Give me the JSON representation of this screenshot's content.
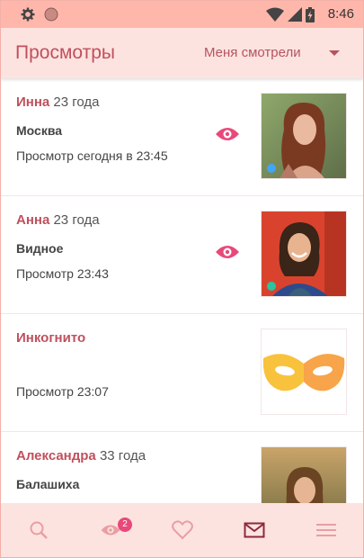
{
  "status": {
    "time": "8:46",
    "icons": [
      "gear-icon",
      "record-icon",
      "wifi-icon",
      "signal-icon",
      "battery-icon"
    ]
  },
  "header": {
    "title": "Просмотры",
    "filter_label": "Меня смотрели"
  },
  "rows": [
    {
      "name": "Инна",
      "age": "23 года",
      "city": "Москва",
      "viewed": "Просмотр сегодня в 23:45",
      "eye": true,
      "online_color": "#42a5f5"
    },
    {
      "name": "Анна",
      "age": "23 года",
      "city": "Видное",
      "viewed": "Просмотр 23:43",
      "eye": true,
      "online_color": "#26c6a0"
    },
    {
      "name": "Инкогнито",
      "age": "",
      "city": "",
      "viewed": "Просмотр 23:07",
      "eye": false
    },
    {
      "name": "Александра",
      "age": "33 года",
      "city": "Балашиха",
      "viewed": "",
      "eye": false
    }
  ],
  "bottom_nav": {
    "items": [
      "search-icon",
      "eye-icon",
      "heart-icon",
      "mail-icon",
      "menu-icon"
    ],
    "views_badge": "2"
  },
  "colors": {
    "accent": "#c0505d",
    "appbar": "#fde3df",
    "statusbar": "#ffb7ab",
    "eye": "#e8497a"
  }
}
